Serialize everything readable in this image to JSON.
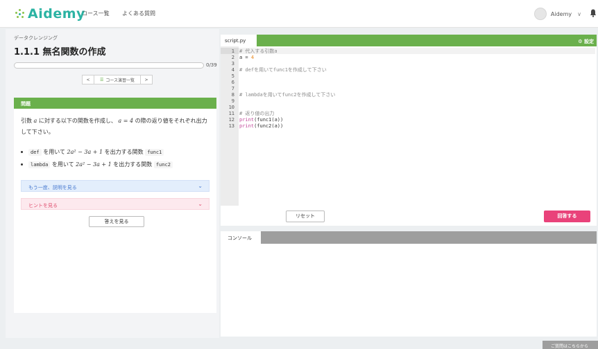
{
  "header": {
    "logo_text": "Aidemy",
    "nav": [
      "コース一覧",
      "よくある質問"
    ],
    "user_name": "Aidemy",
    "user_chevron": "∨",
    "icons": [
      "logo-icon",
      "avatar-icon",
      "chevron-down-icon",
      "bell-icon"
    ]
  },
  "lesson": {
    "category": "データクレンジング",
    "title": "1.1.1 無名関数の作成",
    "progress": {
      "current": 0,
      "total": 39,
      "label": "0/39"
    },
    "pager": {
      "prev": "<",
      "list_label": "コース演習一覧",
      "next": ">"
    }
  },
  "problem": {
    "heading": "問題",
    "text_before": "引数",
    "text_var": "a",
    "text_mid": "に対する以下の関数を作成し、",
    "text_eq": "a = 4",
    "text_after": "の際の返り値をそれぞれ出力して下さい。",
    "bullets": [
      {
        "code": "def",
        "pre": "を用いて",
        "math": "2a² − 3a + 1",
        "post": "を出力する関数",
        "name": "func1"
      },
      {
        "code": "lambda",
        "pre": "を用いて",
        "math": "2a² − 3a + 1",
        "post": "を出力する関数",
        "name": "func2"
      }
    ],
    "explain_again": "もう一度、説明を見る",
    "hint": "ヒントを見る",
    "show_answer": "答えを見る"
  },
  "editor": {
    "file_tab": "script.py",
    "settings_label": "設定",
    "settings_icon": "gear-icon",
    "active_line": 1,
    "lines": [
      "# 代入する引数a",
      "a = 4",
      "",
      "# defを用いてfunc1を作成して下さい",
      "",
      "",
      "",
      "# lambdaを用いてfunc2を作成して下さい",
      "",
      "",
      "# 返り値の出力",
      "print(func1(a))",
      "print(func2(a))"
    ],
    "reset_label": "リセット",
    "submit_label": "回答する"
  },
  "console": {
    "tab_label": "コンソール"
  },
  "footer": {
    "inquiry_label": "ご質問はこちらから"
  }
}
